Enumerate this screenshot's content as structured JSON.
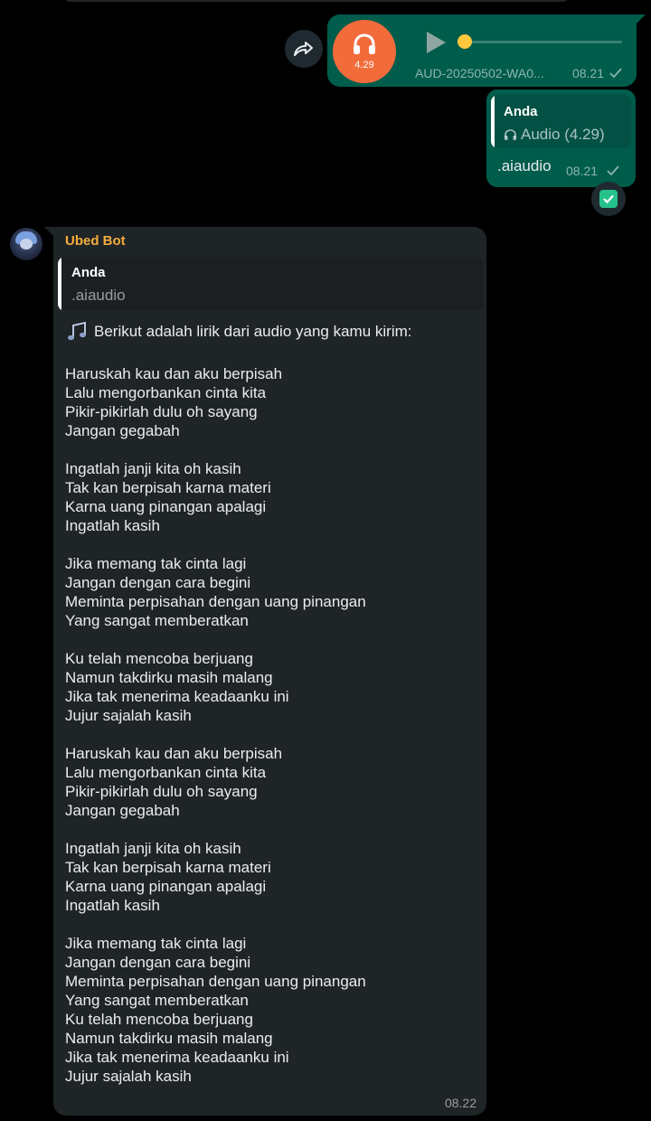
{
  "audio_message": {
    "duration": "4.29",
    "filename": "AUD-20250502-WA0...",
    "time": "08.21",
    "progress": 0,
    "icons": [
      "headphones-icon",
      "play-icon",
      "single-check-icon",
      "forward-icon"
    ]
  },
  "reply_message": {
    "quote_name": "Anda",
    "quote_text": "Audio (4.29)",
    "text": ".aiaudio",
    "time": "08.21"
  },
  "bot_message": {
    "sender": "Ubed Bot",
    "quote_name": "Anda",
    "quote_text": ".aiaudio",
    "intro": "Berikut adalah lirik dari audio yang kamu kirim:",
    "time": "08.22",
    "stanzas": [
      [
        "Haruskah kau dan aku berpisah",
        "Lalu mengorbankan cinta kita",
        "Pikir-pikirlah dulu oh sayang",
        "Jangan gegabah"
      ],
      [
        "Ingatlah janji kita oh kasih",
        "Tak kan berpisah karna materi",
        "Karna uang pinangan apalagi",
        "Ingatlah kasih"
      ],
      [
        "Jika memang tak cinta lagi",
        "Jangan dengan cara begini",
        "Meminta perpisahan dengan uang pinangan",
        "Yang sangat memberatkan"
      ],
      [
        "Ku telah mencoba berjuang",
        "Namun takdirku masih malang",
        "Jika tak menerima keadaanku ini",
        "Jujur sajalah kasih"
      ],
      [
        "Haruskah kau dan aku berpisah",
        "Lalu mengorbankan cinta kita",
        "Pikir-pikirlah dulu oh sayang",
        "Jangan gegabah"
      ],
      [
        "Ingatlah janji kita oh kasih",
        "Tak kan berpisah karna materi",
        "Karna uang pinangan apalagi",
        "Ingatlah kasih"
      ],
      [
        "Jika memang tak cinta lagi",
        "Jangan dengan cara begini",
        "Meminta perpisahan dengan uang pinangan",
        "Yang sangat memberatkan",
        "Ku telah mencoba berjuang",
        "Namun takdirku masih malang",
        "Jika tak menerima keadaanku ini",
        "Jujur sajalah kasih"
      ]
    ]
  },
  "colors": {
    "outgoing_bubble": "#005c4b",
    "incoming_bubble": "#1f2427",
    "sender_name": "#f5ad3c",
    "audio_avatar": "#f26b3a",
    "seek_dot": "#ffc83d",
    "reaction": "#26c28b"
  }
}
